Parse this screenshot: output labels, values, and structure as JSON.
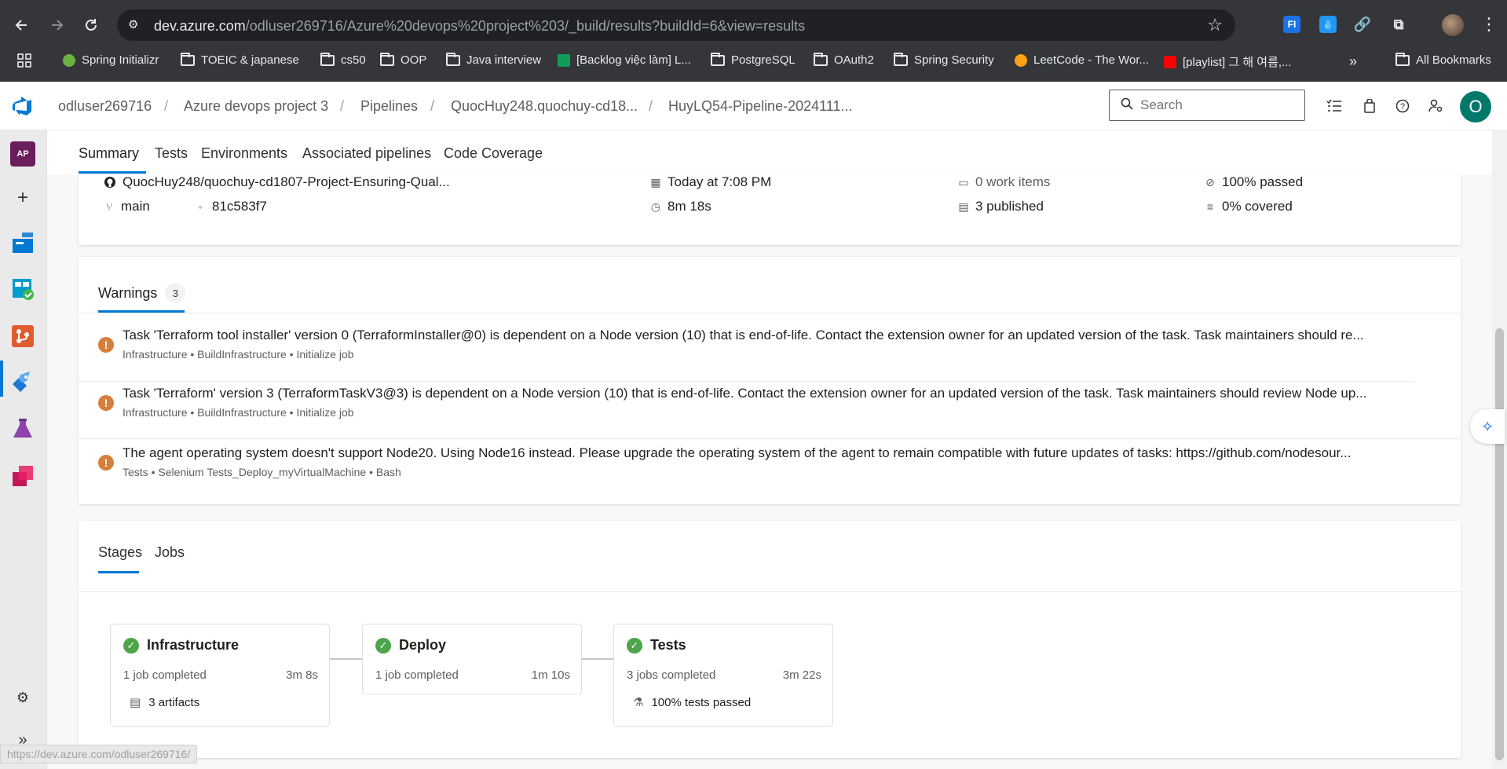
{
  "browser": {
    "url_host": "dev.azure.com",
    "url_path": "/odluser269716/Azure%20devops%20project%203/_build/results?buildId=6&view=results",
    "bookmarks": [
      "Spring Initializr",
      "TOEIC & japanese",
      "cs50",
      "OOP",
      "Java interview",
      "[Backlog việc làm] L...",
      "PostgreSQL",
      "OAuth2",
      "Spring Security",
      "LeetCode - The Wor...",
      "[playlist] 그 해 여름,...",
      "All Bookmarks"
    ],
    "ext_label": "FI"
  },
  "header": {
    "breadcrumbs": [
      "odluser269716",
      "Azure devops project 3",
      "Pipelines",
      "QuocHuy248.quochuy-cd18...",
      "HuyLQ54-Pipeline-2024111..."
    ],
    "search_placeholder": "Search",
    "avatar_initial": "O"
  },
  "rail": {
    "project_initials": "AP"
  },
  "tabs": [
    "Summary",
    "Tests",
    "Environments",
    "Associated pipelines",
    "Code Coverage"
  ],
  "summary": {
    "repo": "QuocHuy248/quochuy-cd1807-Project-Ensuring-Qual...",
    "branch": "main",
    "commit": "81c583f7",
    "time": "Today at 7:08 PM",
    "duration": "8m 18s",
    "work_items": "0 work items",
    "published": "3 published",
    "tests": "100% passed",
    "coverage": "0% covered"
  },
  "warnings": {
    "title": "Warnings",
    "count": "3",
    "items": [
      {
        "message": "Task 'Terraform tool installer' version 0 (TerraformInstaller@0) is dependent on a Node version (10) that is end-of-life. Contact the extension owner for an updated version of the task. Task maintainers should re...",
        "source": "Infrastructure • BuildInfrastructure • Initialize job"
      },
      {
        "message": "Task 'Terraform' version 3 (TerraformTaskV3@3) is dependent on a Node version (10) that is end-of-life. Contact the extension owner for an updated version of the task. Task maintainers should review Node up...",
        "source": "Infrastructure • BuildInfrastructure • Initialize job"
      },
      {
        "message": "The agent operating system doesn't support Node20. Using Node16 instead. Please upgrade the operating system of the agent to remain compatible with future updates of tasks: https://github.com/nodesour...",
        "source": "Tests • Selenium Tests_Deploy_myVirtualMachine • Bash"
      }
    ]
  },
  "stages_section": {
    "tabs": [
      "Stages",
      "Jobs"
    ],
    "stages": [
      {
        "name": "Infrastructure",
        "jobs": "1 job completed",
        "duration": "3m 8s",
        "extra": "3 artifacts"
      },
      {
        "name": "Deploy",
        "jobs": "1 job completed",
        "duration": "1m 10s",
        "extra": ""
      },
      {
        "name": "Tests",
        "jobs": "3 jobs completed",
        "duration": "3m 22s",
        "extra": "100% tests passed"
      }
    ]
  },
  "status_url": "https://dev.azure.com/odluser269716/",
  "colors": {
    "accent": "#0078d4",
    "success": "#4ea44a",
    "warning": "#d67f3c",
    "browser_bg": "#35363a"
  }
}
